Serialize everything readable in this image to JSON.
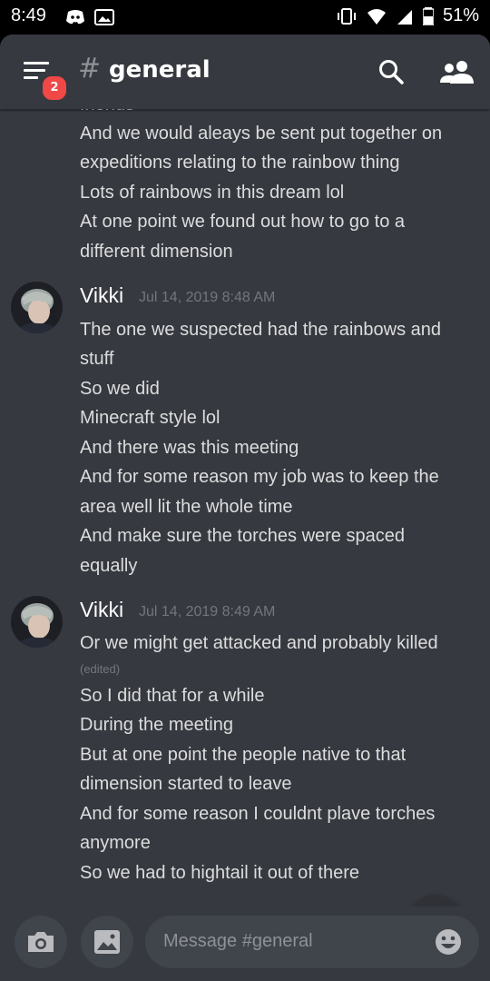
{
  "status_bar": {
    "time": "8:49",
    "battery": "51%"
  },
  "header": {
    "hash": "#",
    "channel": "general",
    "unread_badge": "2"
  },
  "messages": {
    "continuation_lines": [
      "friends",
      "And we would aleays be sent put together on",
      "expeditions relating to the rainbow thing",
      "Lots of rainbows in this dream lol",
      "At one point we found out how to go to a",
      "different dimension"
    ],
    "groups": [
      {
        "author": "Vikki",
        "timestamp": "Jul 14, 2019 8:48 AM",
        "lines": [
          "The one we suspected had the rainbows and",
          "stuff",
          "So we did",
          "Minecraft style lol",
          "And there was this meeting",
          "And for some reason my job was to keep the",
          "area well lit the whole time",
          "And make sure the torches were spaced",
          "equally"
        ]
      },
      {
        "author": "Vikki",
        "timestamp": "Jul 14, 2019 8:49 AM",
        "lines_before_edit": [
          "Or we might get attacked and probably killed"
        ],
        "edited_label": "(edited)",
        "lines": [
          "So I did that for a while",
          "During the meeting",
          "But at one point the people native to that",
          "dimension started to leave",
          "And for some reason I couldnt plave torches",
          "anymore",
          "So we had to hightail it out of there"
        ]
      }
    ]
  },
  "composer": {
    "placeholder": "Message #general"
  },
  "icons": {
    "menu": "hamburger-menu-icon",
    "search": "search-icon",
    "members": "members-icon",
    "camera": "camera-icon",
    "gallery": "image-icon",
    "emoji": "emoji-icon",
    "scroll": "chevron-down-icon"
  },
  "colors": {
    "background": "#36393f",
    "text": "#dcddde",
    "muted": "#72767d",
    "badge": "#f04747",
    "input": "#40444b"
  }
}
